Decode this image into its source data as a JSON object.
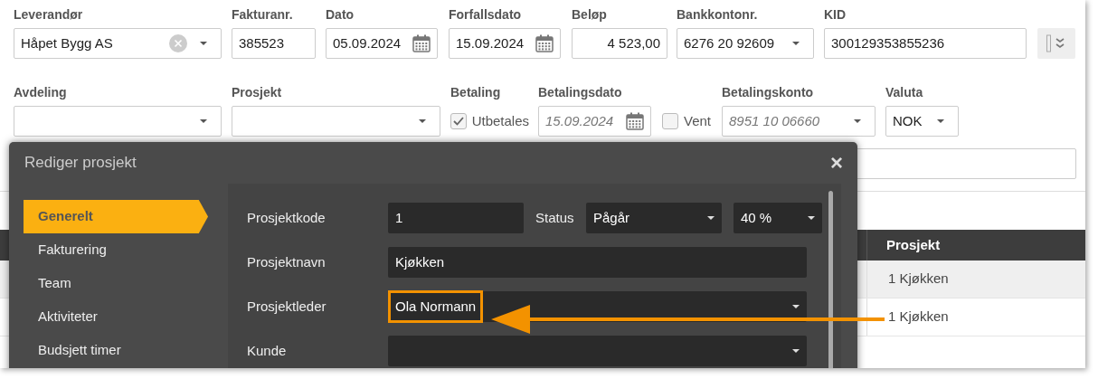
{
  "invoice_form": {
    "rows": [
      {
        "fields": [
          {
            "kind": "combo",
            "label": "Leverandør",
            "value": "Håpet Bygg AS"
          },
          {
            "kind": "text",
            "label": "Fakturanr.",
            "value": "385523"
          },
          {
            "kind": "date",
            "label": "Dato",
            "value": "05.09.2024"
          },
          {
            "kind": "date",
            "label": "Forfallsdato",
            "value": "15.09.2024"
          },
          {
            "kind": "amount",
            "label": "Beløp",
            "value": "4 523,00"
          },
          {
            "kind": "select",
            "label": "Bankkontonr.",
            "value": "6276 20 92609"
          },
          {
            "kind": "text",
            "label": "KID",
            "value": "300129353855236"
          },
          {
            "kind": "expand"
          }
        ]
      },
      {
        "fields": [
          {
            "kind": "select",
            "label": "Avdeling"
          },
          {
            "kind": "select",
            "label": "Prosjekt"
          },
          {
            "kind": "checkbox",
            "label": "Betaling",
            "option": "Utbetales",
            "checked": true
          },
          {
            "kind": "date",
            "label": "Betalingsdato",
            "placeholder": "15.09.2024"
          },
          {
            "kind": "checkbox",
            "option": "Vent",
            "checked": false
          },
          {
            "kind": "select",
            "label": "Betalingskonto",
            "placeholder": "8951 10 06660"
          },
          {
            "kind": "select",
            "label": "Valuta",
            "value": "NOK"
          }
        ]
      }
    ]
  },
  "table": {
    "columns": [
      {
        "label": "Prosjekt"
      }
    ],
    "rows": [
      {
        "prosjekt": "1 Kjøkken"
      },
      {
        "prosjekt": "1 Kjøkken"
      }
    ]
  },
  "dialog": {
    "title": "Rediger prosjekt",
    "close": "×",
    "nav": [
      {
        "label": "Generelt",
        "selected": true
      },
      {
        "label": "Fakturering",
        "selected": false
      },
      {
        "label": "Team",
        "selected": false
      },
      {
        "label": "Aktiviteter",
        "selected": false
      },
      {
        "label": "Budsjett timer",
        "selected": false
      }
    ],
    "fields": [
      {
        "label": "Prosjektkode",
        "value": "1",
        "status_label": "Status",
        "status": "Pågår",
        "progress": "40 %"
      },
      {
        "label": "Prosjektnavn",
        "value": "Kjøkken"
      },
      {
        "label": "Prosjektleder",
        "value": "Ola Normann",
        "kind": "select",
        "highlighted": true
      },
      {
        "label": "Kunde",
        "kind": "select"
      }
    ]
  }
}
